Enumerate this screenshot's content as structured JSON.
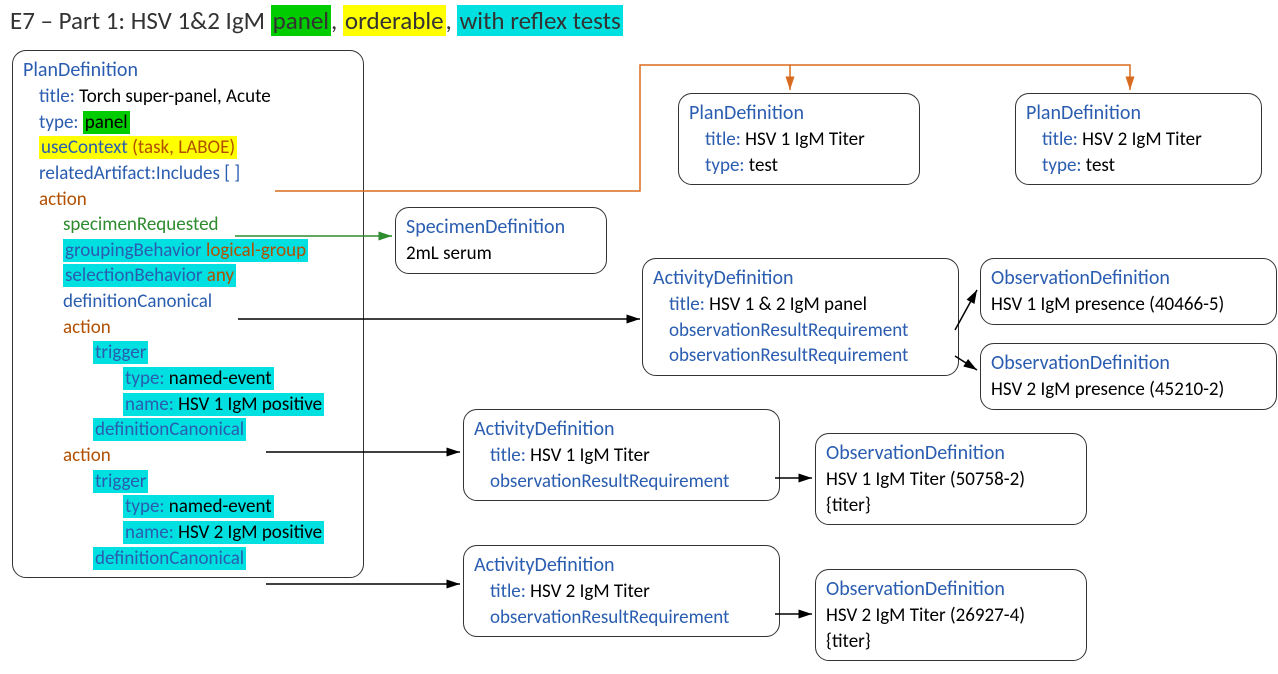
{
  "title": {
    "prefix": "E7 – Part 1: HSV 1&2 IgM ",
    "tag1": "panel",
    "sep1": ", ",
    "tag2": "orderable",
    "sep2": ", ",
    "tag3": "with reflex tests"
  },
  "mainBox": {
    "head": "PlanDefinition",
    "title_l": "title:",
    "title_v": " Torch super-panel, Acute",
    "type_l": "type:",
    "type_v": "panel",
    "useCtx_l": "useContext",
    "useCtx_v": " (task, LABOE)",
    "related_l": "relatedArtifact:Includes [ ]",
    "action": "action",
    "specReq": "specimenRequested",
    "grpBeh_l": "groupingBehavior",
    "grpBeh_v": " logical-group",
    "selBeh_l": "selectionBehavior",
    "selBeh_v": " any",
    "defCan": "definitionCanonical",
    "trigger": "trigger",
    "trigType_l": "type:",
    "trigType_v": " named-event",
    "trigName_l": "name:",
    "trig1Name_v": " HSV 1 IgM positive",
    "trig2Name_v": " HSV 2 IgM positive"
  },
  "specDef": {
    "head": "SpecimenDefinition",
    "body": "2mL serum"
  },
  "pd1": {
    "head": "PlanDefinition",
    "title_l": "title:",
    "title_v": " HSV 1 IgM Titer",
    "type_l": "type:",
    "type_v": " test"
  },
  "pd2": {
    "head": "PlanDefinition",
    "title_l": "title:",
    "title_v": " HSV 2 IgM Titer",
    "type_l": "type:",
    "type_v": " test"
  },
  "ad1": {
    "head": "ActivityDefinition",
    "title_l": "title:",
    "title_v": " HSV 1 & 2 IgM panel",
    "orr": "observationResultRequirement"
  },
  "ad2": {
    "head": "ActivityDefinition",
    "title_l": "title:",
    "title_v": " HSV 1 IgM Titer",
    "orr": "observationResultRequirement"
  },
  "ad3": {
    "head": "ActivityDefinition",
    "title_l": "title:",
    "title_v": " HSV 2 IgM Titer",
    "orr": "observationResultRequirement"
  },
  "od1": {
    "head": "ObservationDefinition",
    "body": "HSV 1 IgM presence (40466-5)"
  },
  "od2": {
    "head": "ObservationDefinition",
    "body": "HSV 2 IgM presence (45210-2)"
  },
  "od3": {
    "head": "ObservationDefinition",
    "body": "HSV 1 IgM Titer (50758-2)",
    "body2": "{titer}"
  },
  "od4": {
    "head": "ObservationDefinition",
    "body": "HSV 2 IgM Titer (26927-4)",
    "body2": "{titer}"
  }
}
